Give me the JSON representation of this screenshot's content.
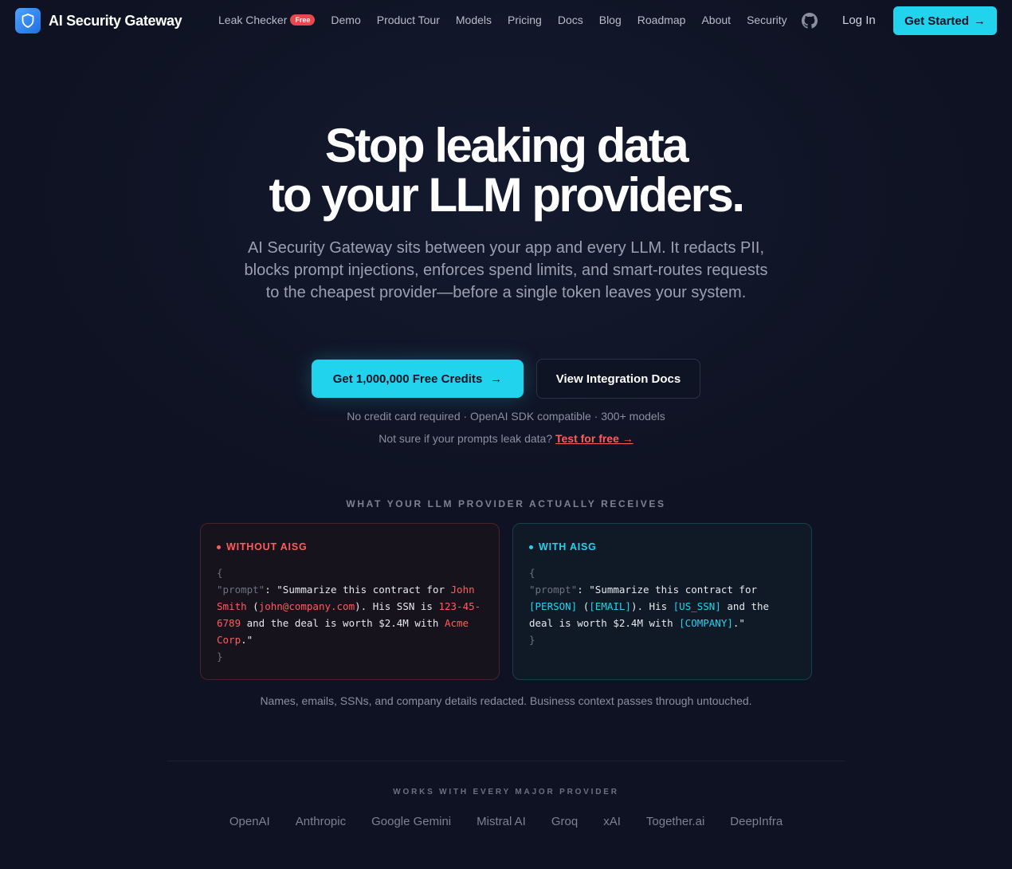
{
  "nav": {
    "brand": "AI Security Gateway",
    "links": [
      {
        "label": "Leak Checker",
        "badge": "Free"
      },
      {
        "label": "Demo"
      },
      {
        "label": "Product Tour"
      },
      {
        "label": "Models"
      },
      {
        "label": "Pricing"
      },
      {
        "label": "Docs"
      },
      {
        "label": "Blog"
      },
      {
        "label": "Roadmap"
      },
      {
        "label": "About"
      },
      {
        "label": "Security"
      }
    ],
    "login": "Log In",
    "get_started": "Get Started",
    "arrow": "→"
  },
  "hero": {
    "title_line1": "Stop leaking data",
    "title_line2": "to your LLM providers.",
    "subtitle": "AI Security Gateway sits between your app and every LLM. It redacts PII, blocks prompt injections, enforces spend limits, and smart-routes requests to the cheapest provider—before a single token leaves your system.",
    "cta_primary": "Get 1,000,000 Free Credits",
    "cta_secondary": "View Integration Docs",
    "meta": "No credit card required · OpenAI SDK compatible · 300+ models",
    "leak_prompt": "Not sure if your prompts leak data?",
    "leak_link": "Test for free →"
  },
  "comparison": {
    "label": "WHAT YOUR LLM PROVIDER ACTUALLY RECEIVES",
    "without": {
      "title": "WITHOUT AISG",
      "open": "{",
      "key": "\"prompt\"",
      "colon": ": ",
      "t1": "\"Summarize this contract for ",
      "name": "John Smith",
      "t2": " (",
      "email": "john@company.com",
      "t3": "). His SSN is ",
      "ssn": "123-45-6789",
      "t4": " and the deal is worth $2.4M with ",
      "company": "Acme Corp",
      "t5": ".\"",
      "close": "}"
    },
    "with": {
      "title": "WITH AISG",
      "open": "{",
      "key": "\"prompt\"",
      "colon": ": ",
      "t1": "\"Summarize this contract for ",
      "name": "[PERSON]",
      "t2": " (",
      "email": "[EMAIL]",
      "t3": "). His ",
      "ssn": "[US_SSN]",
      "t4": " and the deal is worth $2.4M with ",
      "company": "[COMPANY]",
      "t5": ".\"",
      "close": "}"
    },
    "caption": "Names, emails, SSNs, and company details redacted. Business context passes through untouched."
  },
  "providers": {
    "label": "WORKS WITH EVERY MAJOR PROVIDER",
    "items": [
      "OpenAI",
      "Anthropic",
      "Google Gemini",
      "Mistral AI",
      "Groq",
      "xAI",
      "Together.ai",
      "DeepInfra"
    ]
  },
  "icons": {
    "brand": "shield-icon",
    "github": "github-icon"
  },
  "colors": {
    "background": "#0e1222",
    "accent": "#22d3ee",
    "danger": "#ff5c5c"
  }
}
